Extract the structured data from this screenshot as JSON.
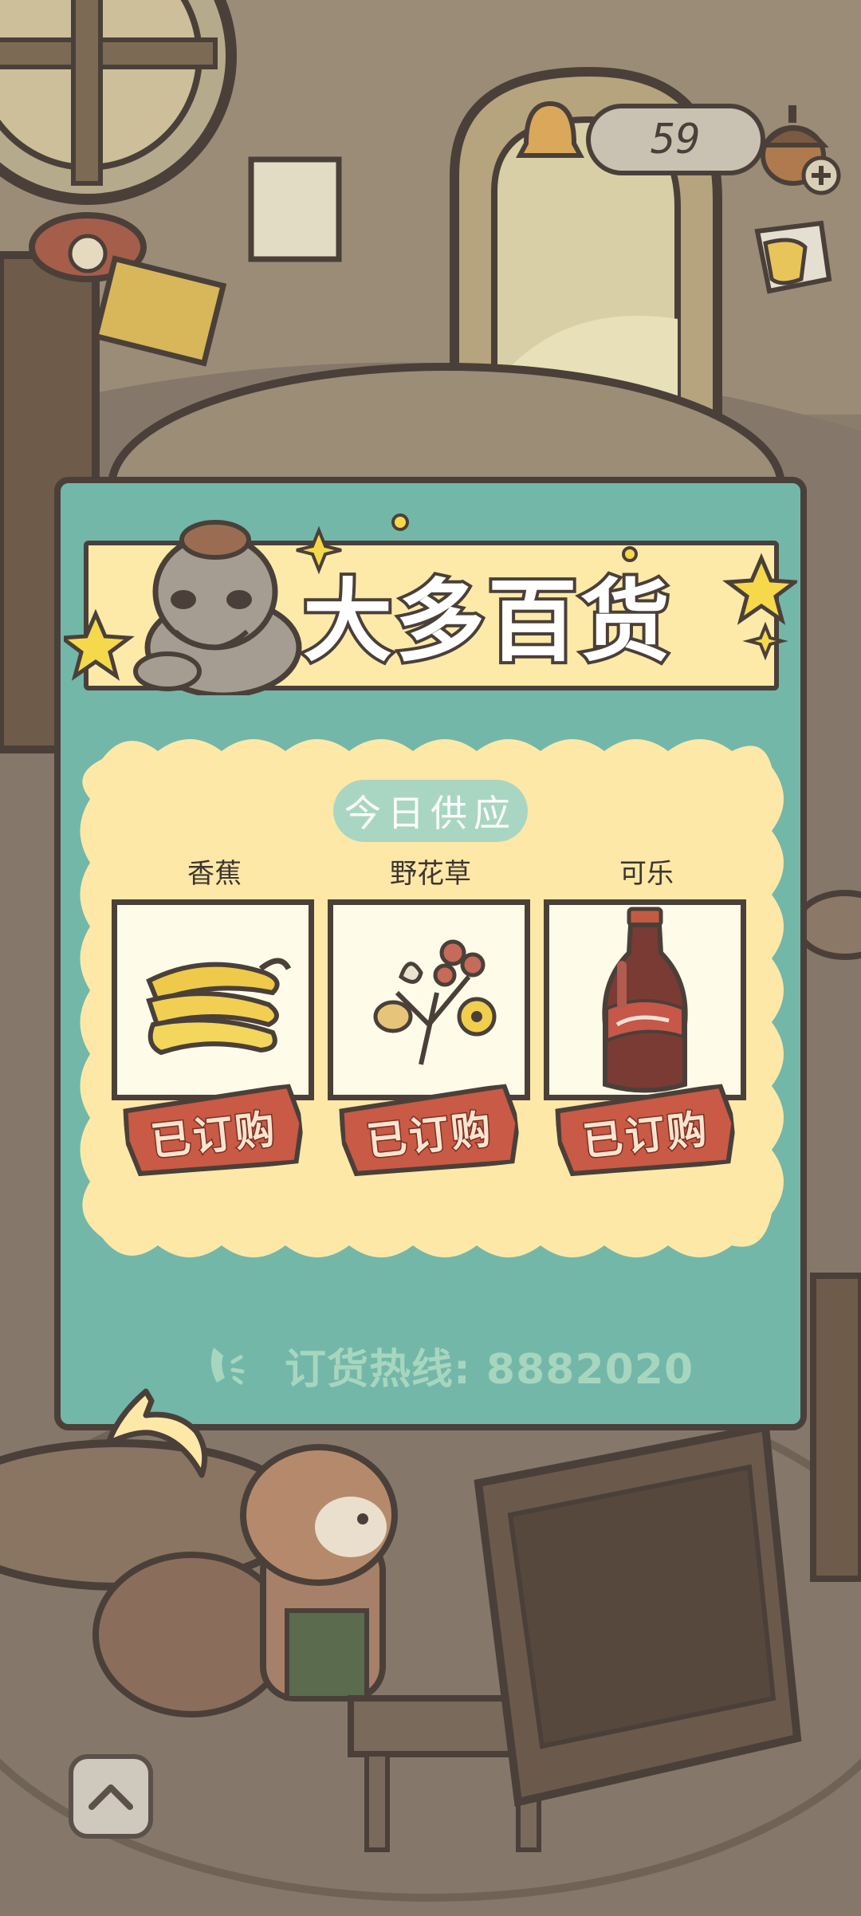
{
  "currency": {
    "value": "59",
    "icon": "acorn-icon"
  },
  "shop": {
    "title": "大多百货",
    "subtitle": "今日供应",
    "items": [
      {
        "name": "香蕉",
        "icon": "banana-icon",
        "status": "已订购"
      },
      {
        "name": "野花草",
        "icon": "wildflowers-icon",
        "status": "已订购"
      },
      {
        "name": "可乐",
        "icon": "cola-bottle-icon",
        "status": "已订购"
      }
    ],
    "hotline": "订货热线: 8882020"
  },
  "colors": {
    "panel": "#73b7a9",
    "banner": "#fdeaa9",
    "outline": "#4a4039",
    "tag": "#c95a45",
    "hotline": "#a7d6bf"
  }
}
